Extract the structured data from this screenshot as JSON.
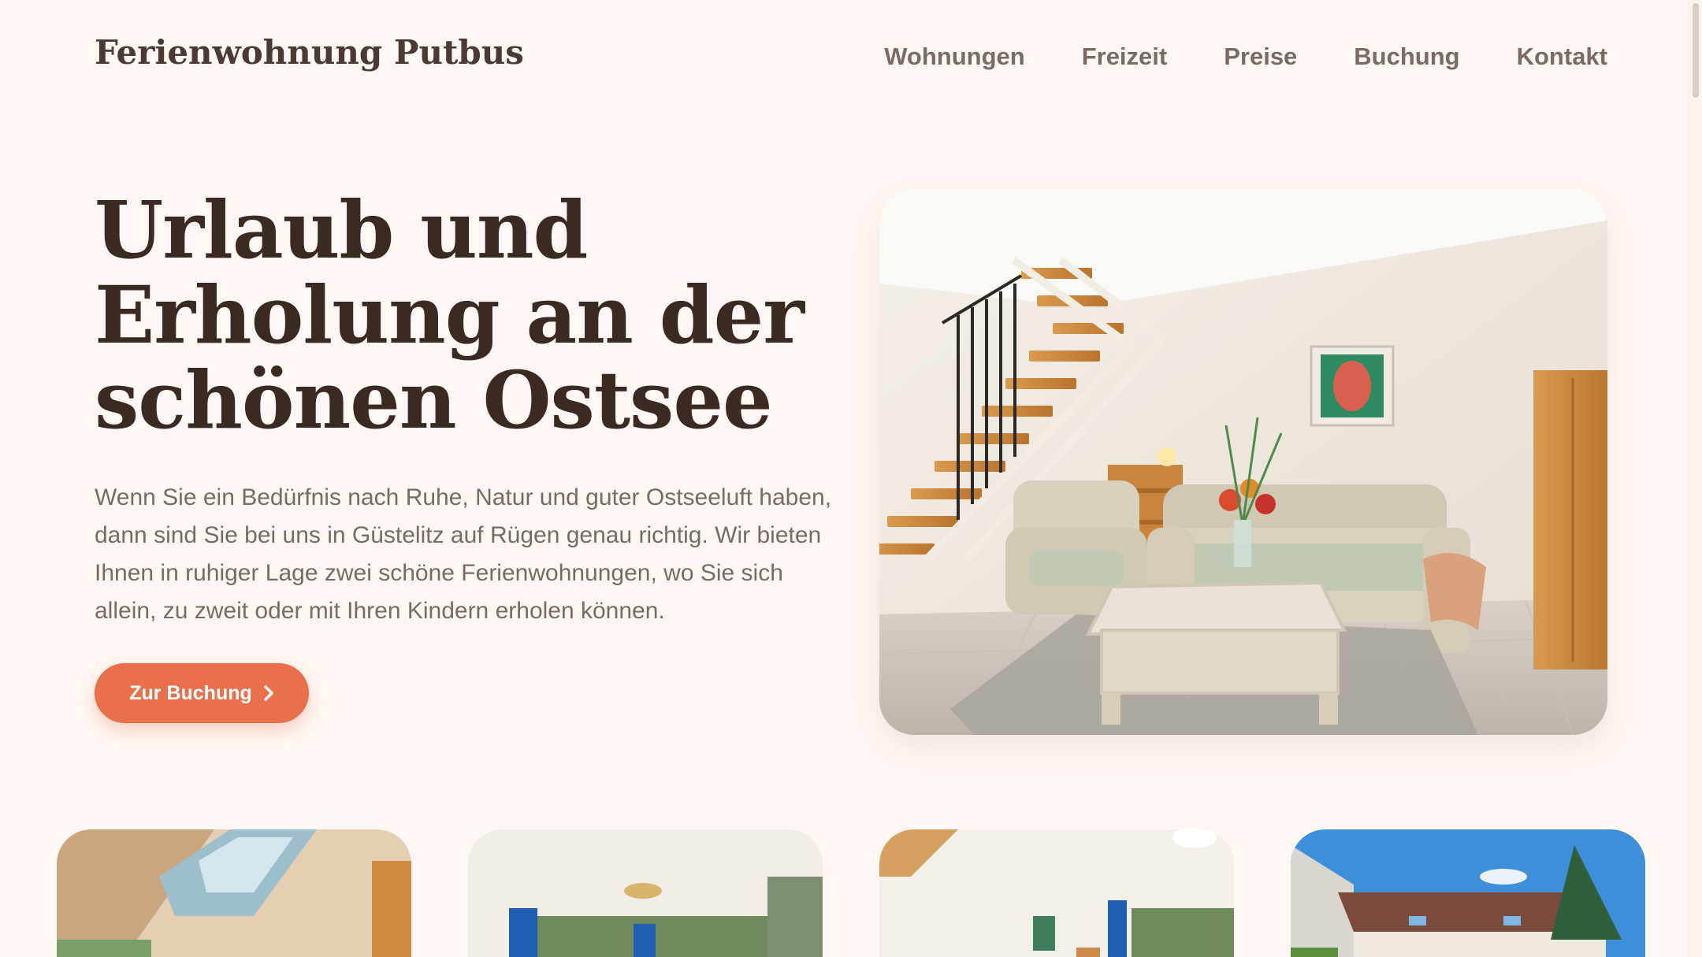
{
  "header": {
    "logo": "Ferienwohnung Putbus",
    "nav": [
      {
        "label": "Wohnungen"
      },
      {
        "label": "Freizeit"
      },
      {
        "label": "Preise"
      },
      {
        "label": "Buchung"
      },
      {
        "label": "Kontakt"
      }
    ]
  },
  "hero": {
    "title_lines": [
      "Urlaub und",
      "Erholung an der",
      "schönen Ostsee"
    ],
    "text": "Wenn Sie ein Bedürfnis nach Ruhe, Natur und guter Ostseeluft haben, dann sind Sie bei uns in Güstelitz auf Rügen genau richtig. Wir bieten Ihnen in ruhiger Lage zwei schöne Ferienwohnungen, wo Sie sich allein, zu zweit oder mit Ihren Kindern erholen können.",
    "cta_label": "Zur Buchung",
    "cta_icon": "chevron-right-icon"
  },
  "colors": {
    "background": "#fff7f3",
    "heading": "#3a2a22",
    "nav_text": "#7a6a62",
    "accent": "#e9704a"
  }
}
